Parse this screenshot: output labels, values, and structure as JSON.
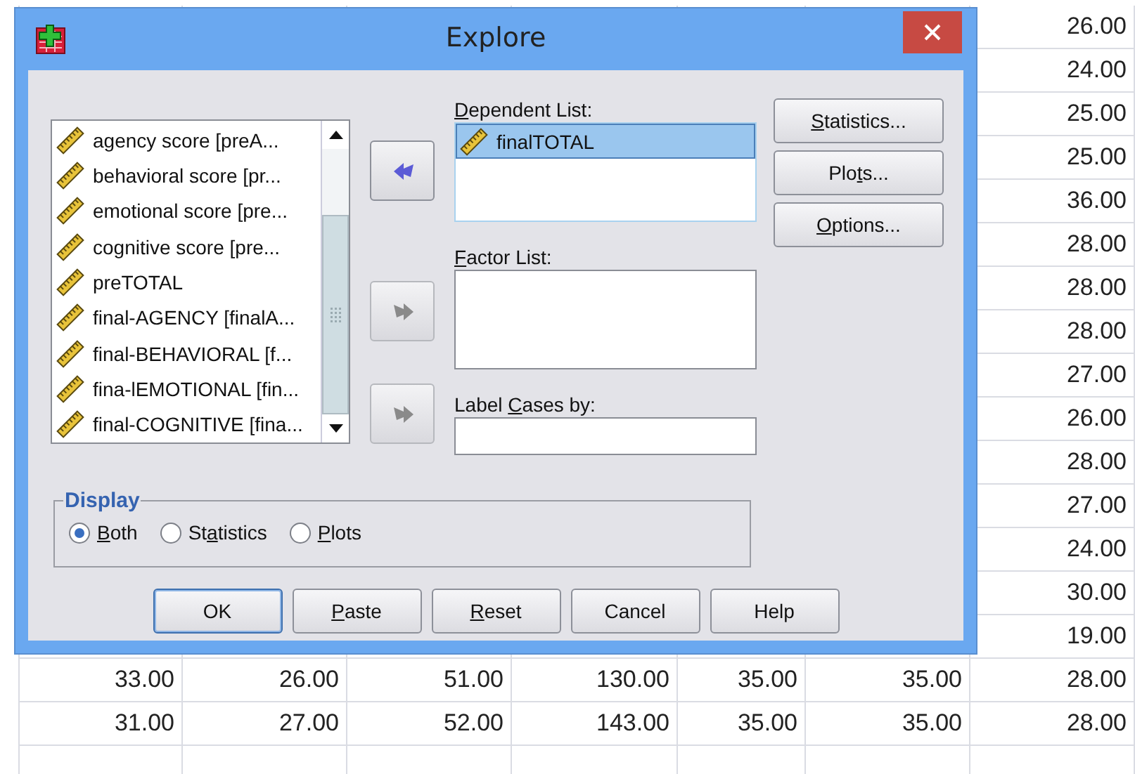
{
  "sheet": {
    "rows": [
      {
        "cells": [
          "26.00"
        ]
      },
      {
        "cells": [
          "24.00"
        ]
      },
      {
        "cells": [
          "25.00"
        ]
      },
      {
        "cells": [
          "25.00"
        ]
      },
      {
        "cells": [
          "36.00"
        ]
      },
      {
        "cells": [
          "28.00"
        ]
      },
      {
        "cells": [
          "28.00"
        ]
      },
      {
        "cells": [
          "28.00"
        ]
      },
      {
        "cells": [
          "27.00"
        ]
      },
      {
        "cells": [
          "26.00"
        ]
      },
      {
        "cells": [
          "28.00"
        ]
      },
      {
        "cells": [
          "27.00"
        ]
      },
      {
        "cells": [
          "24.00"
        ]
      },
      {
        "cells": [
          "30.00"
        ]
      },
      {
        "cells": [
          "19.00"
        ]
      },
      {
        "cells": [
          "33.00",
          "26.00",
          "51.00",
          "130.00",
          "35.00",
          "35.00",
          "28.00"
        ]
      },
      {
        "cells": [
          "31.00",
          "27.00",
          "52.00",
          "143.00",
          "35.00",
          "35.00",
          "28.00"
        ]
      }
    ]
  },
  "dialog": {
    "title": "Explore",
    "source_list": [
      {
        "label": "agency score [preA...",
        "selected": false
      },
      {
        "label": "behavioral score [pr...",
        "selected": false
      },
      {
        "label": "emotional score [pre...",
        "selected": false
      },
      {
        "label": "cognitive score [pre...",
        "selected": false
      },
      {
        "label": "preTOTAL",
        "selected": false
      },
      {
        "label": "final-AGENCY [finalA...",
        "selected": false
      },
      {
        "label": "final-BEHAVIORAL [f...",
        "selected": false
      },
      {
        "label": "fina-lEMOTIONAL [fin...",
        "selected": false
      },
      {
        "label": "final-COGNITIVE [fina...",
        "selected": false
      }
    ],
    "arrow_buttons": [
      {
        "kind": "back",
        "disabled": false
      },
      {
        "kind": "forward",
        "disabled": true
      },
      {
        "kind": "forward",
        "disabled": true
      }
    ],
    "dependent_list": {
      "label": {
        "key": "D",
        "after": "ependent List:"
      },
      "items": [
        {
          "label": "finalTOTAL",
          "selected": true
        }
      ]
    },
    "factor_list": {
      "label": {
        "key": "F",
        "after": "actor List:"
      }
    },
    "label_cases": {
      "label": {
        "before": "Label ",
        "key": "C",
        "after": "ases by:"
      }
    },
    "side_buttons": [
      {
        "label": {
          "key": "S",
          "after": "tatistics..."
        }
      },
      {
        "label": {
          "before": "Plo",
          "key": "t",
          "after": "s..."
        }
      },
      {
        "label": {
          "key": "O",
          "after": "ptions..."
        }
      }
    ],
    "display": {
      "title": "Display",
      "options": [
        {
          "label": {
            "key": "B",
            "after": "oth"
          },
          "selected": true
        },
        {
          "label": {
            "before": "St",
            "key": "a",
            "after": "tistics"
          },
          "selected": false
        },
        {
          "label": {
            "key": "P",
            "after": "lots"
          },
          "selected": false
        }
      ]
    },
    "buttons": [
      {
        "label": {
          "before": "OK"
        },
        "default": true
      },
      {
        "label": {
          "key": "P",
          "after": "aste"
        },
        "default": false
      },
      {
        "label": {
          "key": "R",
          "after": "eset"
        },
        "default": false
      },
      {
        "label": {
          "before": "Cancel"
        },
        "default": false
      },
      {
        "label": {
          "before": "Help"
        },
        "default": false
      }
    ]
  }
}
